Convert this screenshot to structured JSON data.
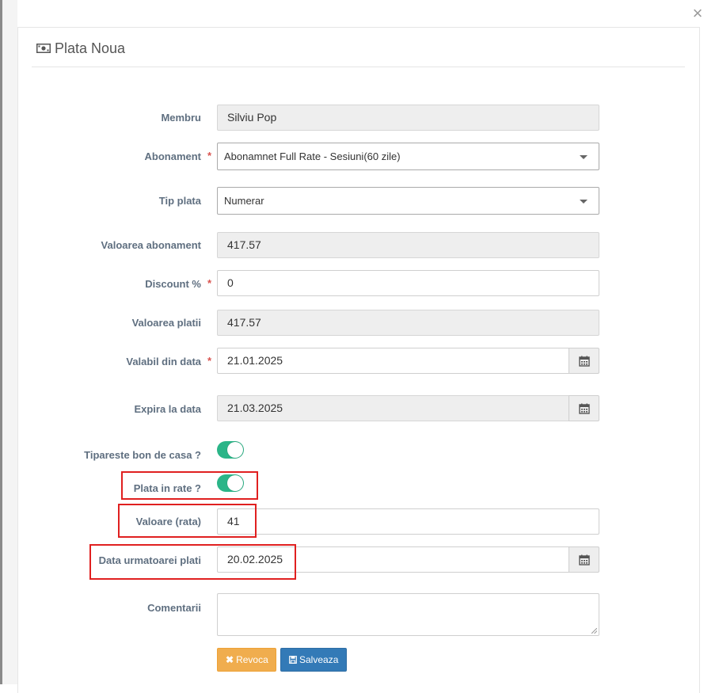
{
  "dialog": {
    "title": "Plata Noua",
    "close_glyph": "×",
    "icon": "money-icon"
  },
  "form": {
    "membru": {
      "label": "Membru",
      "value": "Silviu Pop"
    },
    "abonament": {
      "label": "Abonament",
      "required_mark": "*",
      "value": "Abonamnet Full Rate - Sesiuni(60 zile)"
    },
    "tip_plata": {
      "label": "Tip plata",
      "value": "Numerar"
    },
    "valoarea_abonament": {
      "label": "Valoarea abonament",
      "value": "417.57"
    },
    "discount": {
      "label": "Discount %",
      "required_mark": "*",
      "value": "0"
    },
    "valoarea_platii": {
      "label": "Valoarea platii",
      "value": "417.57"
    },
    "valabil_din": {
      "label": "Valabil din data",
      "required_mark": "*",
      "value": "21.01.2025"
    },
    "expira": {
      "label": "Expira la data",
      "value": "21.03.2025"
    },
    "tipareste_bon": {
      "label": "Tipareste bon de casa ?",
      "checked": true
    },
    "plata_in_rate": {
      "label": "Plata in rate ?",
      "checked": true
    },
    "valoare_rata": {
      "label": "Valoare (rata)",
      "value": "41"
    },
    "data_urmatoarei_plati": {
      "label": "Data urmatoarei plati",
      "value": "20.02.2025"
    },
    "comentarii": {
      "label": "Comentarii",
      "value": ""
    }
  },
  "buttons": {
    "revoca": {
      "label": "Revoca",
      "icon": "close-icon"
    },
    "salveaza": {
      "label": "Salveaza",
      "icon": "save-icon"
    }
  },
  "colors": {
    "toggle_on": "#2bb588",
    "revoca_bg": "#f0ad4e",
    "salveaza_bg": "#337ab7",
    "required": "#d9534f",
    "highlight_box": "#e02020",
    "label_text": "#5f6f80"
  }
}
